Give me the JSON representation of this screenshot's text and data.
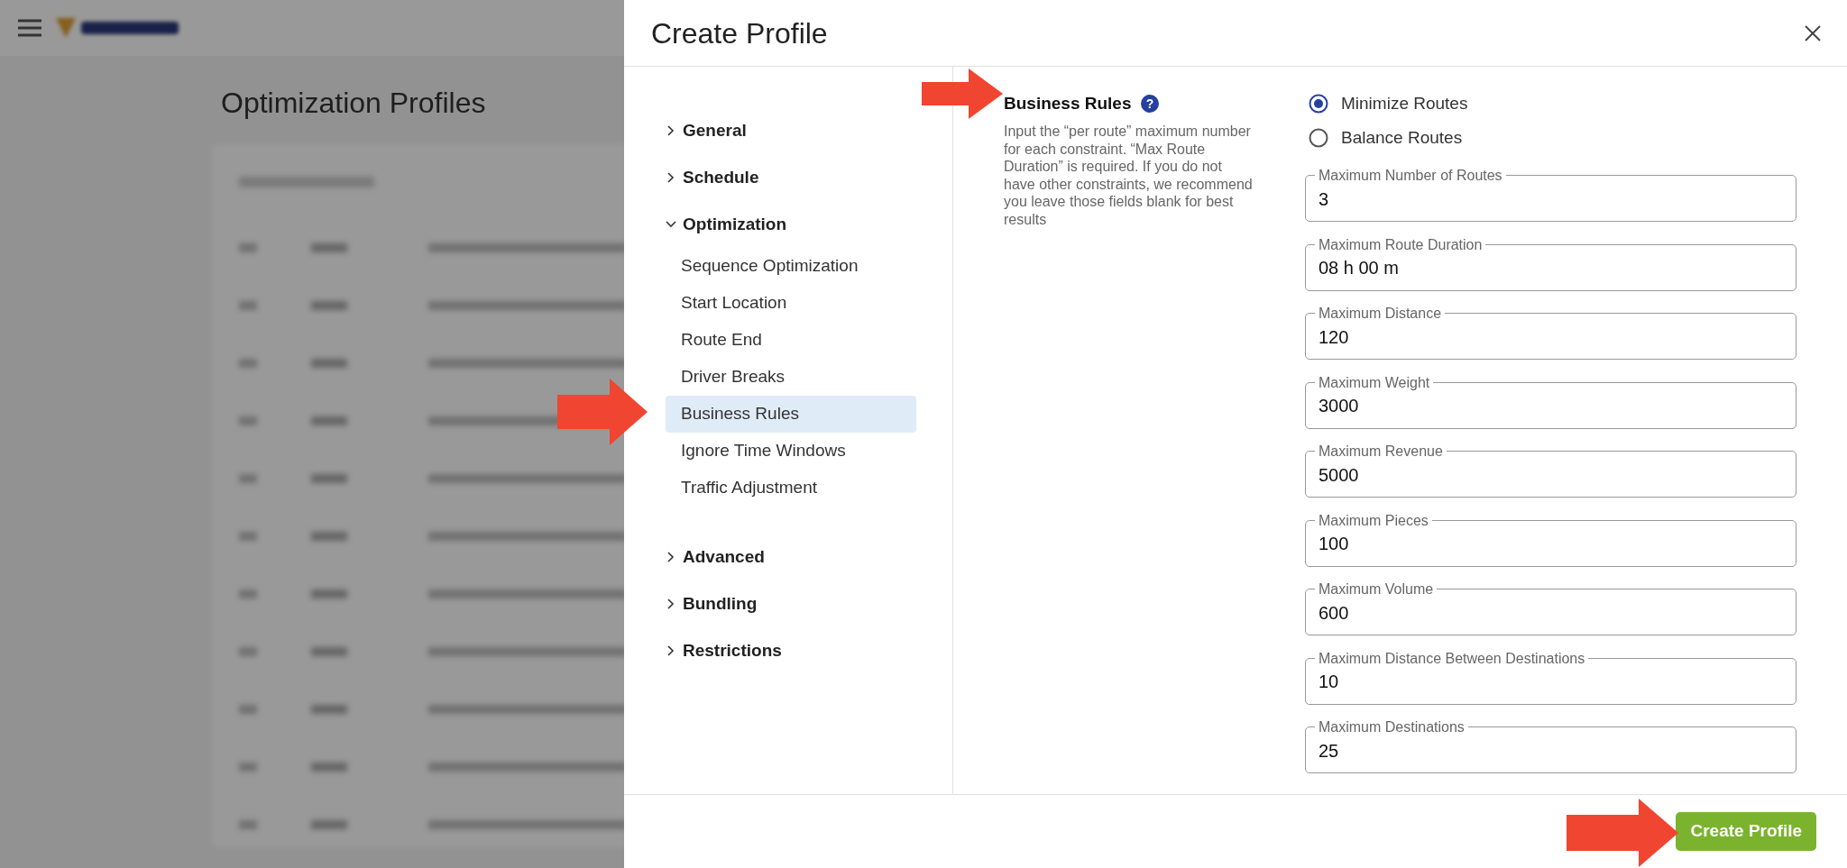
{
  "background_page": {
    "title": "Optimization Profiles"
  },
  "modal": {
    "title": "Create Profile",
    "nav": [
      {
        "label": "General",
        "expanded": false
      },
      {
        "label": "Schedule",
        "expanded": false
      },
      {
        "label": "Optimization",
        "expanded": true,
        "children": [
          {
            "label": "Sequence Optimization",
            "selected": false
          },
          {
            "label": "Start Location",
            "selected": false
          },
          {
            "label": "Route End",
            "selected": false
          },
          {
            "label": "Driver Breaks",
            "selected": false
          },
          {
            "label": "Business Rules",
            "selected": true
          },
          {
            "label": "Ignore Time Windows",
            "selected": false
          },
          {
            "label": "Traffic Adjustment",
            "selected": false
          }
        ]
      },
      {
        "label": "Advanced",
        "expanded": false
      },
      {
        "label": "Bundling",
        "expanded": false
      },
      {
        "label": "Restrictions",
        "expanded": false
      }
    ],
    "section": {
      "title": "Business Rules",
      "help_icon": "?",
      "description": "Input the “per route” maximum number for each constraint. “Max Route Duration” is required. If you do not have other constraints, we recommend you leave those fields blank for best results"
    },
    "radios": [
      {
        "label": "Minimize Routes",
        "selected": true
      },
      {
        "label": "Balance Routes",
        "selected": false
      }
    ],
    "fields": [
      {
        "label": "Maximum Number of Routes",
        "value": "3"
      },
      {
        "label": "Maximum Route Duration",
        "value": "08 h 00 m"
      },
      {
        "label": "Maximum Distance",
        "value": "120"
      },
      {
        "label": "Maximum Weight",
        "value": "3000"
      },
      {
        "label": "Maximum Revenue",
        "value": "5000"
      },
      {
        "label": "Maximum Pieces",
        "value": "100"
      },
      {
        "label": "Maximum Volume",
        "value": "600"
      },
      {
        "label": "Maximum Distance Between Destinations",
        "value": "10"
      },
      {
        "label": "Maximum Destinations",
        "value": "25"
      }
    ],
    "primary_button": "Create Profile"
  }
}
